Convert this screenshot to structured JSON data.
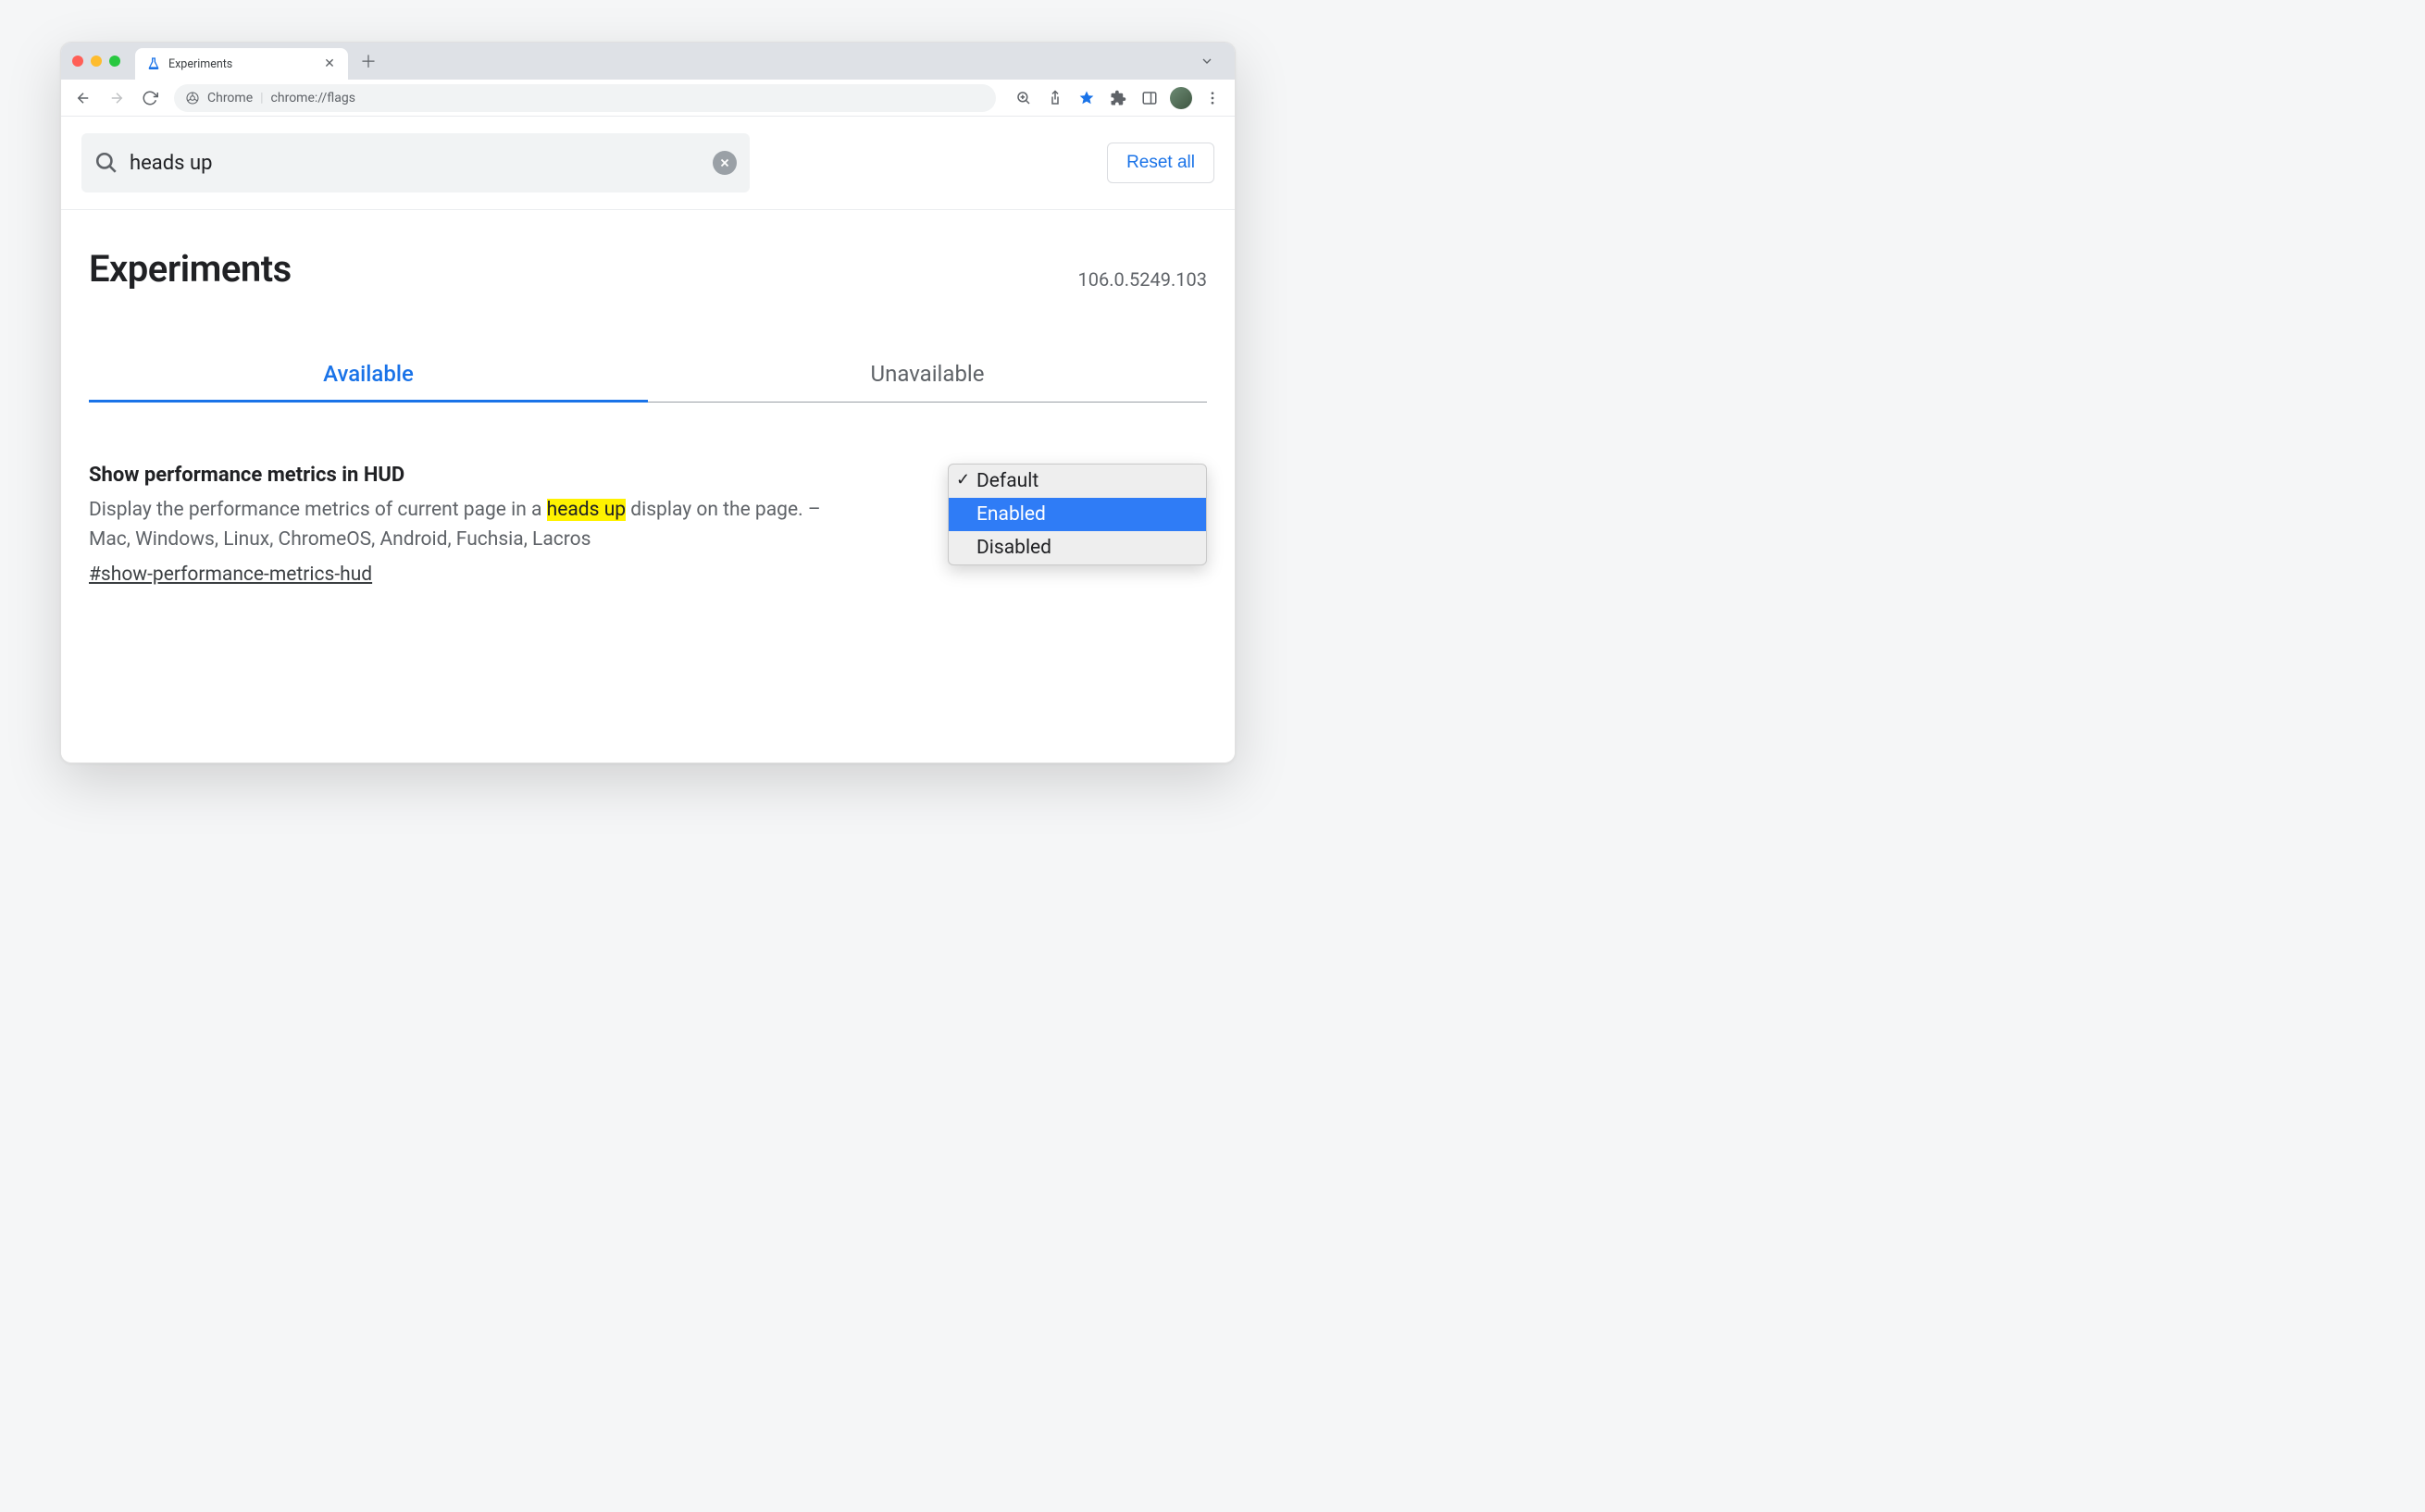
{
  "window": {
    "tab_title": "Experiments"
  },
  "toolbar": {
    "origin_label": "Chrome",
    "url": "chrome://flags"
  },
  "search": {
    "query": "heads up",
    "reset_label": "Reset all"
  },
  "header": {
    "page_title": "Experiments",
    "version": "106.0.5249.103"
  },
  "tabs": {
    "available": "Available",
    "unavailable": "Unavailable"
  },
  "flag": {
    "title": "Show performance metrics in HUD",
    "desc_before": "Display the performance metrics of current page in a ",
    "desc_highlight": "heads up",
    "desc_after": " display on the page. – Mac, Windows, Linux, ChromeOS, Android, Fuchsia, Lacros",
    "anchor": "#show-performance-metrics-hud"
  },
  "dropdown": {
    "options": {
      "default": "Default",
      "enabled": "Enabled",
      "disabled": "Disabled"
    }
  }
}
